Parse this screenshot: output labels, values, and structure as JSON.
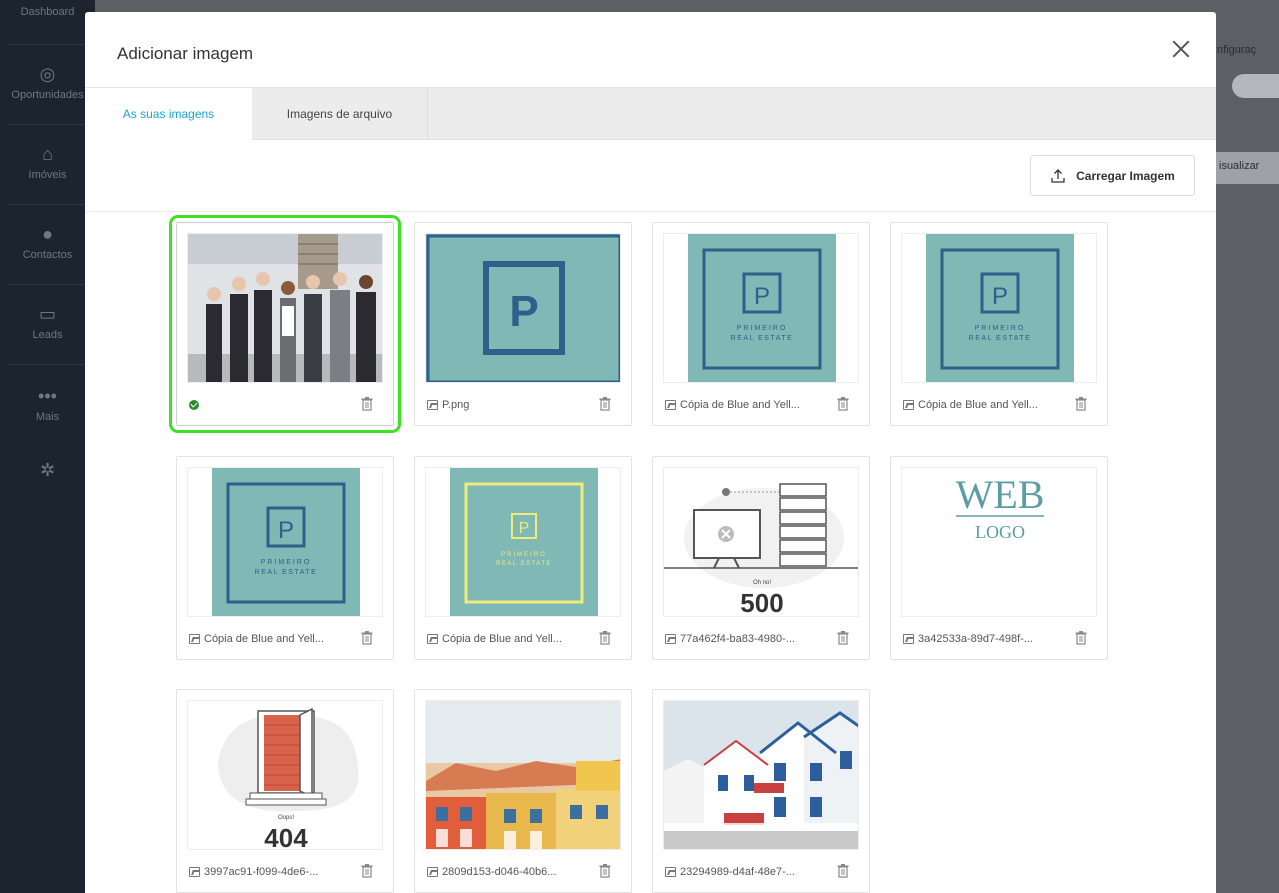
{
  "background": {
    "sidebar": {
      "items": [
        {
          "label": "Dashboard",
          "icon": "dashboard-icon"
        },
        {
          "label": "Oportunidades",
          "icon": "target-icon"
        },
        {
          "label": "Imóveis",
          "icon": "home-icon"
        },
        {
          "label": "Contactos",
          "icon": "person-icon"
        },
        {
          "label": "Leads",
          "icon": "inbox-icon"
        },
        {
          "label": "Mais",
          "icon": "more-icon"
        }
      ]
    },
    "right_text_1": "nfiguraç",
    "right_text_2": "isualizar"
  },
  "modal": {
    "title": "Adicionar imagem",
    "tabs": [
      {
        "label": "As suas imagens",
        "active": true
      },
      {
        "label": "Imagens de arquivo",
        "active": false
      }
    ],
    "upload_label": "Carregar Imagem",
    "images": [
      {
        "name": "",
        "selected": true,
        "kind": "photo-team"
      },
      {
        "name": "P.png",
        "selected": false,
        "kind": "logo-p"
      },
      {
        "name": "Cópia de Blue and Yell...",
        "selected": false,
        "kind": "logo-primeiro"
      },
      {
        "name": "Cópia de Blue and Yell...",
        "selected": false,
        "kind": "logo-primeiro"
      },
      {
        "name": "Cópia de Blue and Yell...",
        "selected": false,
        "kind": "logo-primeiro"
      },
      {
        "name": "Cópia de Blue and Yell...",
        "selected": false,
        "kind": "logo-primeiro-yellow"
      },
      {
        "name": "77a462f4-ba83-4980-...",
        "selected": false,
        "kind": "error-500"
      },
      {
        "name": "3a42533a-89d7-498f-...",
        "selected": false,
        "kind": "web-logo"
      },
      {
        "name": "3997ac91-f099-4de6-...",
        "selected": false,
        "kind": "error-404"
      },
      {
        "name": "2809d153-d046-40b6...",
        "selected": false,
        "kind": "photo-houses"
      },
      {
        "name": "23294989-d4af-48e7-...",
        "selected": false,
        "kind": "photo-striped-houses"
      }
    ],
    "thumb_text": {
      "p_letter": "P",
      "primeiro_line1": "PRIMEIRO",
      "primeiro_line2": "REAL ESTATE",
      "web": "WEB",
      "logo": "LOGO",
      "oh_no": "Oh no!",
      "code_500": "500",
      "oops": "Oops!",
      "code_404": "404"
    }
  },
  "colors": {
    "accent": "#1aa3d9",
    "selected_outline": "#3fe024",
    "teal": "#7fb8b5",
    "navy": "#2f5f8a",
    "yellow": "#f0ec7a"
  }
}
